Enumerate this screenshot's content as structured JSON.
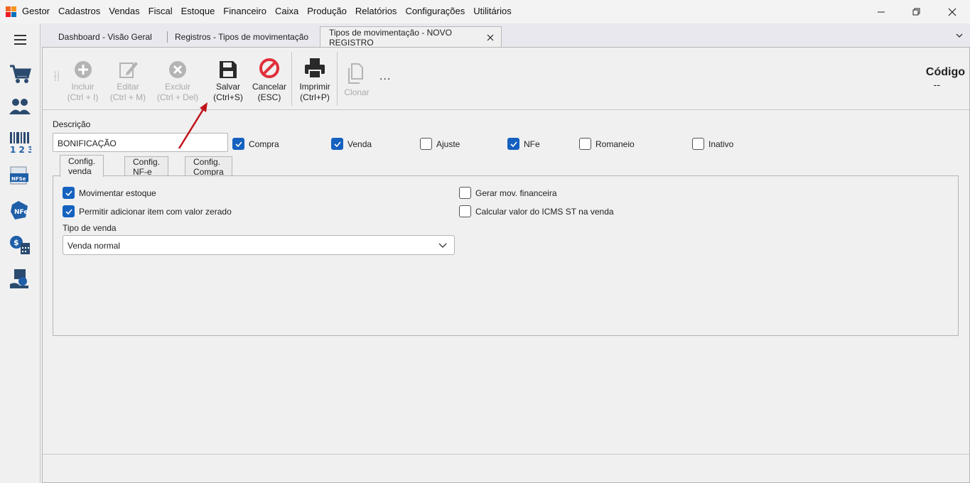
{
  "app": {
    "title": "Gestor",
    "menu": [
      "Cadastros",
      "Vendas",
      "Fiscal",
      "Estoque",
      "Financeiro",
      "Caixa",
      "Produção",
      "Relatórios",
      "Configurações",
      "Utilitários"
    ]
  },
  "tabs": [
    {
      "label": "Dashboard - Visão Geral"
    },
    {
      "label": "Registros - Tipos de movimentação"
    },
    {
      "label": "Tipos de movimentação - NOVO REGISTRO"
    }
  ],
  "toolbar": {
    "incluir": {
      "label": "Incluir",
      "shortcut": "(Ctrl + I)"
    },
    "editar": {
      "label": "Editar",
      "shortcut": "(Ctrl + M)"
    },
    "excluir": {
      "label": "Excluir",
      "shortcut": "(Ctrl + Del)"
    },
    "salvar": {
      "label": "Salvar",
      "shortcut": "(Ctrl+S)"
    },
    "cancelar": {
      "label": "Cancelar",
      "shortcut": "(ESC)"
    },
    "imprimir": {
      "label": "Imprimir",
      "shortcut": "(Ctrl+P)"
    },
    "clonar": {
      "label": "Clonar"
    },
    "more": "..."
  },
  "codigo": {
    "label": "Código",
    "value": "--"
  },
  "form": {
    "descricao_label": "Descrição",
    "descricao_value": "BONIFICAÇÃO",
    "flags": [
      {
        "label": "Compra",
        "checked": true
      },
      {
        "label": "Venda",
        "checked": true
      },
      {
        "label": "Ajuste",
        "checked": false
      },
      {
        "label": "NFe",
        "checked": true
      },
      {
        "label": "Romaneio",
        "checked": false
      },
      {
        "label": "Inativo",
        "checked": false
      }
    ]
  },
  "subtabs": [
    "Config. venda",
    "Config. NF-e",
    "Config. Compra"
  ],
  "venda": {
    "movimentar_estoque": {
      "label": "Movimentar estoque",
      "checked": true
    },
    "permitir_zerado": {
      "label": "Permitir adicionar item com valor zerado",
      "checked": true
    },
    "gerar_financeira": {
      "label": "Gerar mov. financeira",
      "checked": false
    },
    "calcular_icms": {
      "label": "Calcular valor do ICMS ST na venda",
      "checked": false
    },
    "tipo_label": "Tipo de venda",
    "tipo_value": "Venda normal"
  },
  "colors": {
    "accent": "#1561c0",
    "arrow": "#c0141b",
    "cancel": "#e0303a"
  }
}
